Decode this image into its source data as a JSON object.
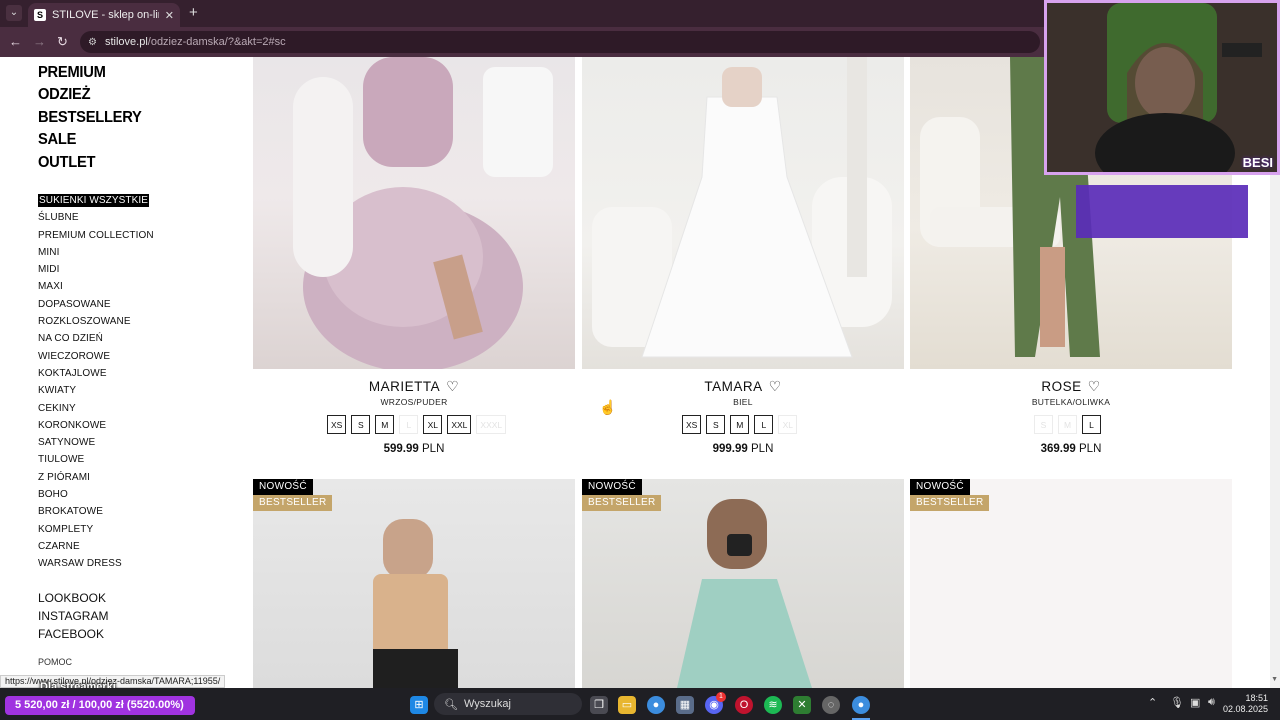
{
  "browser": {
    "tab_title": "STILOVE - sklep on-line",
    "favicon_letter": "S",
    "url_host": "stilove.pl",
    "url_path": "/odziez-damska/?&akt=2#sc"
  },
  "sidebar": {
    "main_items": [
      "PREMIUM",
      "ODZIEŻ",
      "BESTSELLERY",
      "SALE",
      "OUTLET"
    ],
    "categories": [
      "SUKIENKI WSZYSTKIE",
      "ŚLUBNE",
      "PREMIUM COLLECTION",
      "MINI",
      "MIDI",
      "MAXI",
      "DOPASOWANE",
      "ROZKLOSZOWANE",
      "NA CO DZIEŃ",
      "WIECZOROWE",
      "KOKTAJLOWE",
      "KWIATY",
      "CEKINY",
      "KORONKOWE",
      "SATYNOWE",
      "TIULOWE",
      "Z PIÓRAMI",
      "BOHO",
      "BROKATOWE",
      "KOMPLETY",
      "CZARNE",
      "WARSAW DRESS"
    ],
    "links": [
      "LOOKBOOK",
      "INSTAGRAM",
      "FACEBOOK"
    ],
    "help": "POMOC"
  },
  "products": [
    {
      "name": "MARIETTA",
      "color": "WRZOS/PUDER",
      "sizes": [
        {
          "label": "XS",
          "available": true
        },
        {
          "label": "S",
          "available": true
        },
        {
          "label": "M",
          "available": true
        },
        {
          "label": "L",
          "available": false
        },
        {
          "label": "XL",
          "available": true
        },
        {
          "label": "XXL",
          "available": true
        },
        {
          "label": "XXXL",
          "available": false
        }
      ],
      "price_value": "599.99",
      "currency": "PLN"
    },
    {
      "name": "TAMARA",
      "color": "BIEL",
      "sizes": [
        {
          "label": "XS",
          "available": true
        },
        {
          "label": "S",
          "available": true
        },
        {
          "label": "M",
          "available": true
        },
        {
          "label": "L",
          "available": true
        },
        {
          "label": "XL",
          "available": false
        }
      ],
      "price_value": "999.99",
      "currency": "PLN"
    },
    {
      "name": "ROSE",
      "color": "BUTELKA/OLIWKA",
      "sizes": [
        {
          "label": "S",
          "available": false
        },
        {
          "label": "M",
          "available": false
        },
        {
          "label": "L",
          "available": true
        }
      ],
      "price_value": "369.99",
      "currency": "PLN"
    }
  ],
  "badges": {
    "new": "NOWOŚĆ",
    "bestseller": "BESTSELLER"
  },
  "status_url": "https://www.stilove.pl/odziez-damska/TAMARA;11955/",
  "overlay": {
    "streamer_label": "Dla streamerki",
    "donation": "5 520,00 zł / 100,00 zł (5520.00%)",
    "cam_tag": "BESI"
  },
  "taskbar": {
    "search_placeholder": "Wyszukaj",
    "time": "18:51",
    "date": "02.08.2025",
    "discord_badge": "1"
  },
  "colors": {
    "accent_purple": "#a033e0",
    "bestseller_gold": "#c4a56a",
    "chrome_bg": "#4a2d40"
  }
}
